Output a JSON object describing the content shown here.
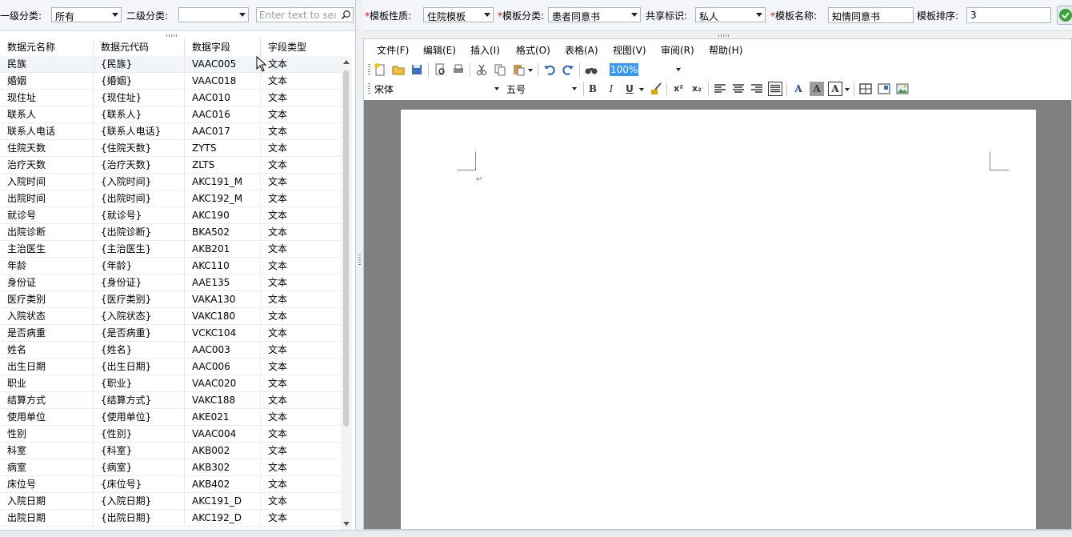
{
  "left_filter": {
    "level1_label": "一级分类:",
    "level1_value": "所有",
    "level2_label": "二级分类:",
    "level2_value": "",
    "search_placeholder": "Enter text to search"
  },
  "grid": {
    "columns": [
      "数据元名称",
      "数据元代码",
      "数据字段",
      "字段类型"
    ],
    "selected_row": 0,
    "rows": [
      [
        "民族",
        "{民族}",
        "VAAC005",
        "文本"
      ],
      [
        "婚姻",
        "{婚姻}",
        "VAAC018",
        "文本"
      ],
      [
        "现住址",
        "{现住址}",
        "AAC010",
        "文本"
      ],
      [
        "联系人",
        "{联系人}",
        "AAC016",
        "文本"
      ],
      [
        "联系人电话",
        "{联系人电话}",
        "AAC017",
        "文本"
      ],
      [
        "住院天数",
        "{住院天数}",
        "ZYTS",
        "文本"
      ],
      [
        "治疗天数",
        "{治疗天数}",
        "ZLTS",
        "文本"
      ],
      [
        "入院时间",
        "{入院时间}",
        "AKC191_M",
        "文本"
      ],
      [
        "出院时间",
        "{出院时间}",
        "AKC192_M",
        "文本"
      ],
      [
        "就诊号",
        "{就诊号}",
        "AKC190",
        "文本"
      ],
      [
        "出院诊断",
        "{出院诊断}",
        "BKA502",
        "文本"
      ],
      [
        "主治医生",
        "{主治医生}",
        "AKB201",
        "文本"
      ],
      [
        "年龄",
        "{年龄}",
        "AKC110",
        "文本"
      ],
      [
        "身份证",
        "{身份证}",
        "AAE135",
        "文本"
      ],
      [
        "医疗类别",
        "{医疗类别}",
        "VAKA130",
        "文本"
      ],
      [
        "入院状态",
        "{入院状态}",
        "VAKC180",
        "文本"
      ],
      [
        "是否病重",
        "{是否病重}",
        "VCKC104",
        "文本"
      ],
      [
        "姓名",
        "{姓名}",
        "AAC003",
        "文本"
      ],
      [
        "出生日期",
        "{出生日期}",
        "AAC006",
        "文本"
      ],
      [
        "职业",
        "{职业}",
        "VAAC020",
        "文本"
      ],
      [
        "结算方式",
        "{结算方式}",
        "VAKC188",
        "文本"
      ],
      [
        "使用单位",
        "{使用单位}",
        "AKE021",
        "文本"
      ],
      [
        "性别",
        "{性别}",
        "VAAC004",
        "文本"
      ],
      [
        "科室",
        "{科室}",
        "AKB002",
        "文本"
      ],
      [
        "病室",
        "{病室}",
        "AKB302",
        "文本"
      ],
      [
        "床位号",
        "{床位号}",
        "AKB402",
        "文本"
      ],
      [
        "入院日期",
        "{入院日期}",
        "AKC191_D",
        "文本"
      ],
      [
        "出院日期",
        "{出院日期}",
        "AKC192_D",
        "文本"
      ]
    ]
  },
  "template_bar": {
    "required_mark": "*",
    "nature_label": "模板性质:",
    "nature_value": "住院模板",
    "category_label": "模板分类:",
    "category_value": "患者同意书",
    "share_label": "共享标识:",
    "share_value": "私人",
    "name_label": "模板名称:",
    "name_value": "知情同意书",
    "order_label": "模板排序:",
    "order_value": "3"
  },
  "editor": {
    "menus": [
      "文件(F)",
      "编辑(E)",
      "插入(I)",
      "格式(O)",
      "表格(A)",
      "视图(V)",
      "审阅(R)",
      "帮助(H)"
    ],
    "zoom": "100%",
    "font_name": "宋体",
    "font_size": "五号",
    "bold": "B",
    "italic": "I",
    "underline": "U",
    "superscript": "x²",
    "subscript": "x₂",
    "font_color_glyph": "A",
    "highlight_glyph": "A",
    "char_border_glyph": "A",
    "paragraph_mark": "↵"
  },
  "colors": {
    "required": "#e00000",
    "selection": "#3399ff",
    "doc_background": "#808080",
    "ok": "#3aa33a"
  },
  "icons": [
    "new-doc-icon",
    "open-folder-icon",
    "save-icon",
    "print-preview-icon",
    "print-icon",
    "cut-icon",
    "copy-icon",
    "paste-icon",
    "undo-icon",
    "redo-icon",
    "find-icon",
    "align-left-icon",
    "align-center-icon",
    "align-right-icon",
    "justify-icon",
    "table-icon",
    "image-icon",
    "ok-icon"
  ]
}
